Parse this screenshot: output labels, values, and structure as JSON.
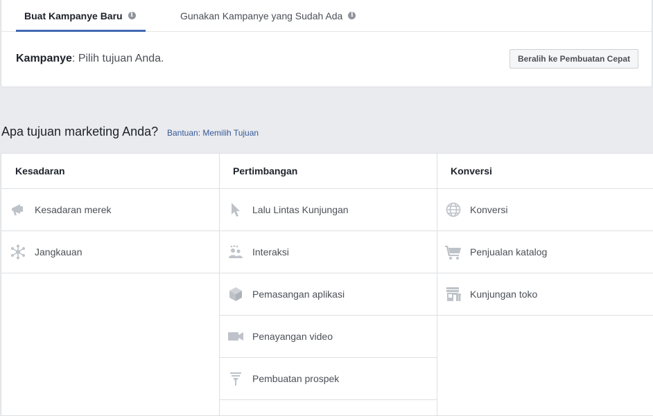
{
  "tabs": [
    {
      "label": "Buat Kampanye Baru",
      "active": true
    },
    {
      "label": "Gunakan Kampanye yang Sudah Ada",
      "active": false
    }
  ],
  "campaign": {
    "label": "Kampanye",
    "text": ": Pilih tujuan Anda."
  },
  "quick_button": "Beralih ke Pembuatan Cepat",
  "question": "Apa tujuan marketing Anda?",
  "help_link": "Bantuan: Memilih Tujuan",
  "columns": [
    {
      "title": "Kesadaran",
      "items": [
        {
          "label": "Kesadaran merek",
          "icon": "megaphone-icon"
        },
        {
          "label": "Jangkauan",
          "icon": "reach-icon"
        }
      ]
    },
    {
      "title": "Pertimbangan",
      "items": [
        {
          "label": "Lalu Lintas Kunjungan",
          "icon": "cursor-icon"
        },
        {
          "label": "Interaksi",
          "icon": "people-icon"
        },
        {
          "label": "Pemasangan aplikasi",
          "icon": "box-icon"
        },
        {
          "label": "Penayangan video",
          "icon": "video-camera-icon"
        },
        {
          "label": "Pembuatan prospek",
          "icon": "funnel-icon"
        }
      ]
    },
    {
      "title": "Konversi",
      "items": [
        {
          "label": "Konversi",
          "icon": "globe-icon"
        },
        {
          "label": "Penjualan katalog",
          "icon": "cart-icon"
        },
        {
          "label": "Kunjungan toko",
          "icon": "store-icon"
        }
      ]
    }
  ],
  "colors": {
    "accent": "#4267b2",
    "link": "#365899",
    "icon": "#bec3c9"
  }
}
